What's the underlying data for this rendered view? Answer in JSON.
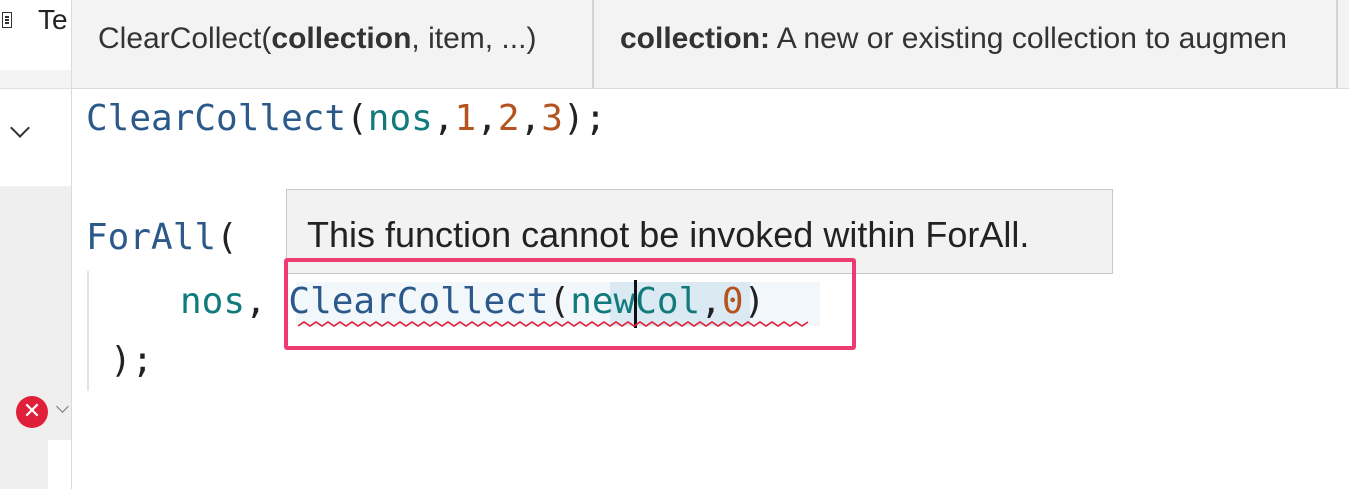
{
  "left_panel": {
    "tab_label": "Te",
    "error_icon": "x-icon",
    "error_glyph": "✕"
  },
  "signature_help": {
    "function_name": "ClearCollect(",
    "active_param": "collection",
    "rest_params": ", item, ...)",
    "param_name": "collection:",
    "param_desc": " A new or existing collection to augmen"
  },
  "editor": {
    "line1": {
      "fn": "ClearCollect",
      "open": "(",
      "arg0": "nos",
      "c1": ",",
      "n1": "1",
      "c2": ",",
      "n2": "2",
      "c3": ",",
      "n3": "3",
      "close": ");"
    },
    "line2": {
      "fn": "ForAll",
      "open": "("
    },
    "line3": {
      "arg": "nos",
      "comma": ",",
      "fn": "ClearCollect",
      "open": "(",
      "param": "newCol",
      "comma2": ",",
      "num": "0",
      "close": ")"
    },
    "line4": {
      "close": ");"
    }
  },
  "tooltip": {
    "message": "This function cannot be invoked within ForAll."
  },
  "colors": {
    "highlight_border": "#ee3c72",
    "error_red": "#e0203a",
    "function_color": "#2b5a8a",
    "identifier_color": "#117a7a",
    "number_color": "#b3541e"
  }
}
